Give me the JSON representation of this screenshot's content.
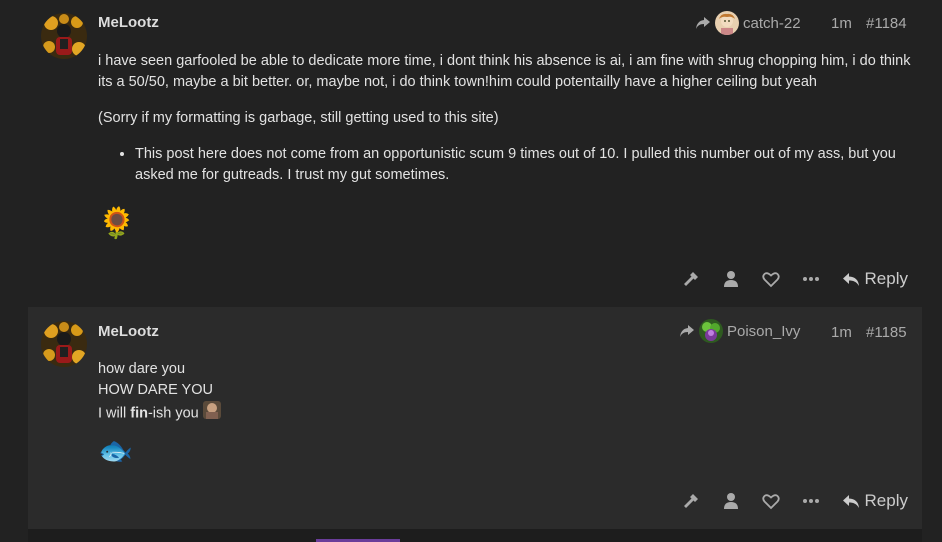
{
  "posts": [
    {
      "username": "MeLootz",
      "reply_to": "catch-22",
      "time": "1m",
      "number": "#1184",
      "paragraph1": "i have seen garfooled be able to dedicate more time, i dont think his absence is ai, i am fine with shrug chopping him, i do think its a 50/50, maybe a bit better. or, maybe not, i do think town!him could potentailly have a higher ceiling but yeah",
      "paragraph2": "(Sorry if my formatting is garbage, still getting used to this site)",
      "bullet": "This post here does not come from an opportunistic scum 9 times out of 10. I pulled this number out of my ass, but you asked me for gutreads. I trust my gut sometimes.",
      "emoji": "🌻",
      "reply_label": "Reply"
    },
    {
      "username": "MeLootz",
      "reply_to": "Poison_Ivy",
      "time": "1m",
      "number": "#1185",
      "line1": "how dare you",
      "line2": "HOW DARE YOU",
      "line3_pre": "I will ",
      "line3_bold": "fin",
      "line3_post": "-ish you",
      "emoji": "🐟",
      "reply_label": "Reply"
    }
  ],
  "colors": {
    "background": "#222222",
    "post_highlight": "#2b2b2b",
    "accent": "#6a3d9a"
  }
}
